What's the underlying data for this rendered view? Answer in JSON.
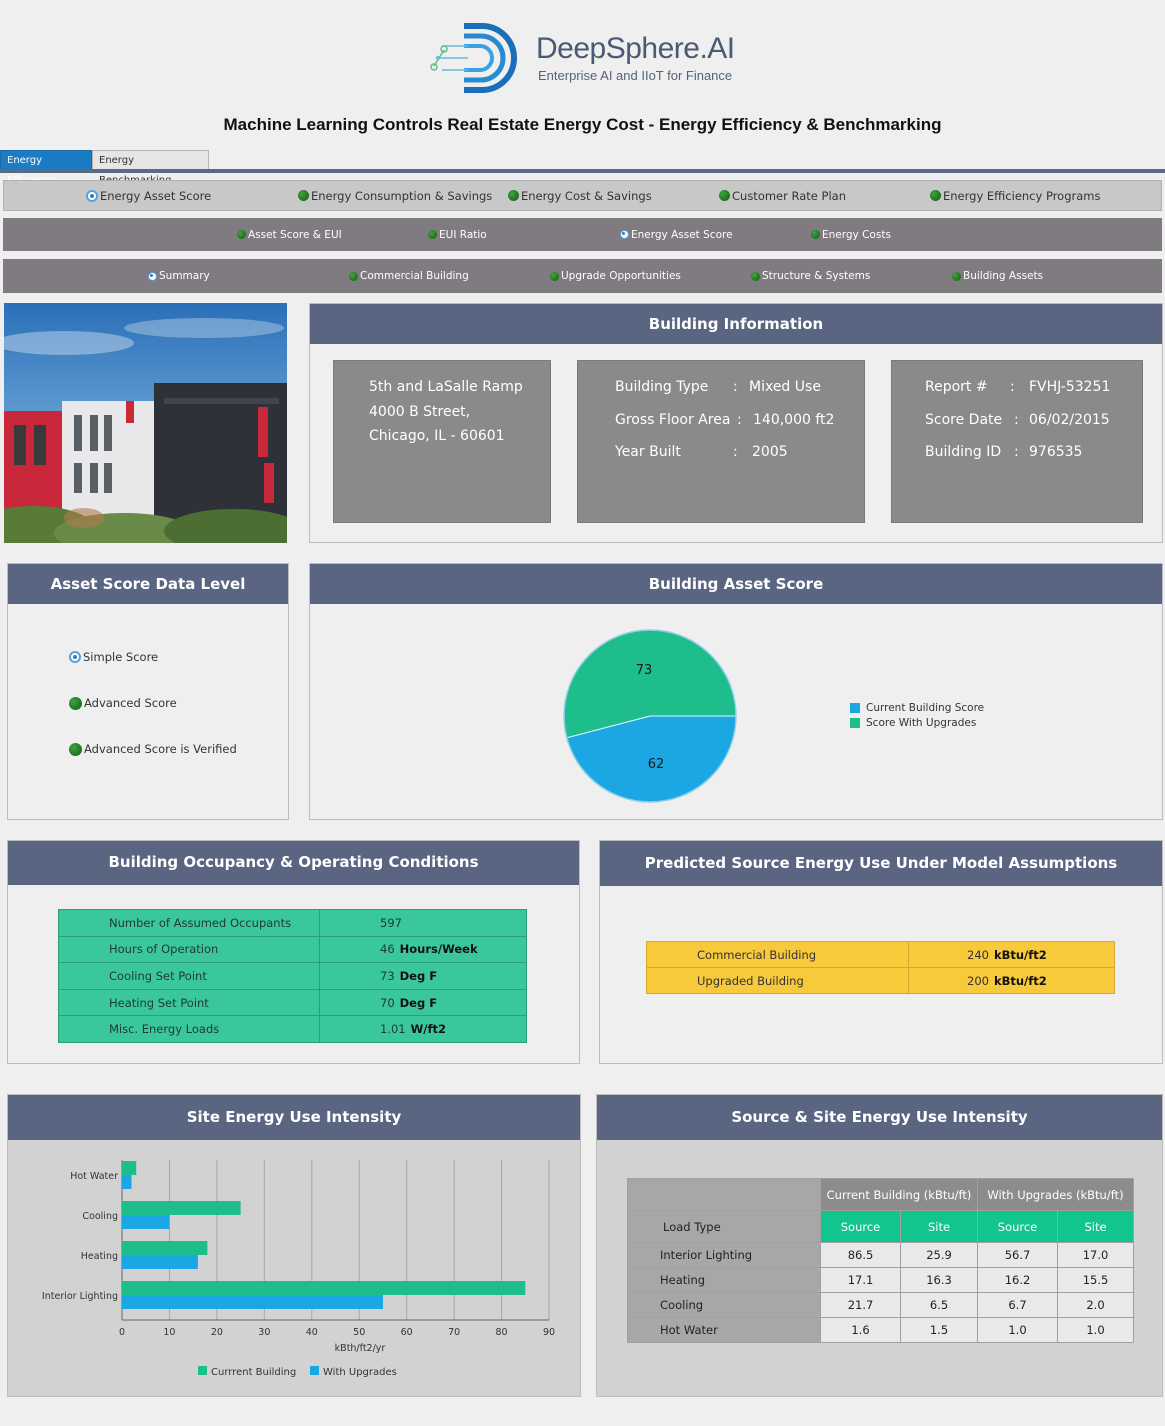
{
  "brand": {
    "name": "DeepSphere.AI",
    "tagline": "Enterprise AI and IIoT for Finance"
  },
  "page_title": "Machine Learning Controls Real Estate Energy Cost - Energy Efficiency & Benchmarking",
  "tabs": [
    {
      "label": "Energy Efficiency",
      "active": true
    },
    {
      "label": "Energy Benchmarking",
      "active": false
    }
  ],
  "nav1": [
    {
      "label": "Energy Asset Score",
      "selected": true
    },
    {
      "label": "Energy Consumption & Savings",
      "selected": false
    },
    {
      "label": "Energy Cost & Savings",
      "selected": false
    },
    {
      "label": "Customer Rate Plan",
      "selected": false
    },
    {
      "label": "Energy Efficiency Programs",
      "selected": false
    }
  ],
  "nav2": [
    {
      "label": "Asset Score & EUI",
      "selected": false
    },
    {
      "label": "EUI Ratio",
      "selected": false
    },
    {
      "label": "Energy Asset Score",
      "selected": true
    },
    {
      "label": "Energy Costs",
      "selected": false
    }
  ],
  "nav3": [
    {
      "label": "Summary",
      "selected": true
    },
    {
      "label": "Commercial Building",
      "selected": false
    },
    {
      "label": "Upgrade Opportunities",
      "selected": false
    },
    {
      "label": "Structure & Systems",
      "selected": false
    },
    {
      "label": "Building Assets",
      "selected": false
    }
  ],
  "building_info": {
    "title": "Building Information",
    "address": [
      "5th and LaSalle Ramp",
      "4000 B Street,",
      "Chicago, IL - 60601"
    ],
    "building_type_label": "Building Type",
    "building_type": "Mixed Use",
    "gross_floor_area_label": "Gross Floor Area",
    "gross_floor_area": "140,000 ft2",
    "year_built_label": "Year Built",
    "year_built": "2005",
    "report_label": "Report #",
    "report": "FVHJ-53251",
    "score_date_label": "Score Date",
    "score_date": "06/02/2015",
    "building_id_label": "Building ID",
    "building_id": "976535",
    "sep": ":"
  },
  "asset_score_level": {
    "title": "Asset Score Data Level",
    "options": [
      {
        "label": "Simple Score",
        "selected": true
      },
      {
        "label": "Advanced Score",
        "selected": false
      },
      {
        "label": "Advanced Score is Verified",
        "selected": false
      }
    ]
  },
  "building_asset_score": {
    "title": "Building Asset Score",
    "chart_data": {
      "type": "pie",
      "title": "Building Asset Score",
      "slices": [
        {
          "name": "Current Building Score",
          "value": 62,
          "color": "#1aa7e4"
        },
        {
          "name": "Score With Upgrades",
          "value": 73,
          "color": "#1dbd8c"
        }
      ],
      "legend": "right"
    }
  },
  "occupancy": {
    "title": "Building Occupancy & Operating Conditions",
    "rows": [
      {
        "label": "Number of Assumed Occupants",
        "value": "597",
        "unit": ""
      },
      {
        "label": "Hours of Operation",
        "value": "46",
        "unit": "Hours/Week"
      },
      {
        "label": "Cooling Set Point",
        "value": "73",
        "unit": "Deg F"
      },
      {
        "label": "Heating Set Point",
        "value": "70",
        "unit": "Deg F"
      },
      {
        "label": "Misc. Energy Loads",
        "value": "1.01",
        "unit": "W/ft2"
      }
    ]
  },
  "predicted": {
    "title": "Predicted Source Energy Use Under Model Assumptions",
    "rows": [
      {
        "label": "Commercial Building",
        "value": "240",
        "unit": "kBtu/ft2"
      },
      {
        "label": "Upgraded Building",
        "value": "200",
        "unit": "kBtu/ft2"
      }
    ]
  },
  "site_eui": {
    "title": "Site Energy Use Intensity",
    "chart_data": {
      "type": "bar",
      "orientation": "horizontal",
      "categories": [
        "Hot Water",
        "Cooling",
        "Heating",
        "Interior Lighting"
      ],
      "series": [
        {
          "name": "Currrent Building",
          "values": [
            3,
            25,
            18,
            85
          ],
          "color": "#1dbd8c"
        },
        {
          "name": "With Upgrades",
          "values": [
            2,
            10,
            16,
            55
          ],
          "color": "#1aa7e4"
        }
      ],
      "xlabel": "kBth/ft2/yr",
      "xlim": [
        0,
        90
      ],
      "xticks": [
        "0",
        "10",
        "20",
        "30",
        "40",
        "50",
        "60",
        "70",
        "80",
        "90"
      ],
      "grid": true,
      "legend": "bottom"
    }
  },
  "source_site": {
    "title": "Source & Site Energy Use Intensity",
    "group_current": "Current Building (kBtu/ft)",
    "group_upgrades": "With Upgrades (kBtu/ft)",
    "load_type": "Load Type",
    "source": "Source",
    "site": "Site",
    "rows": [
      {
        "load": "Interior Lighting",
        "cur_source": "86.5",
        "cur_site": "25.9",
        "up_source": "56.7",
        "up_site": "17.0"
      },
      {
        "load": "Heating",
        "cur_source": "17.1",
        "cur_site": "16.3",
        "up_source": "16.2",
        "up_site": "15.5"
      },
      {
        "load": "Cooling",
        "cur_source": "21.7",
        "cur_site": "6.5",
        "up_source": "6.7",
        "up_site": "2.0"
      },
      {
        "load": "Hot Water",
        "cur_source": "1.6",
        "cur_site": "1.5",
        "up_source": "1.0",
        "up_site": "1.0"
      }
    ]
  }
}
